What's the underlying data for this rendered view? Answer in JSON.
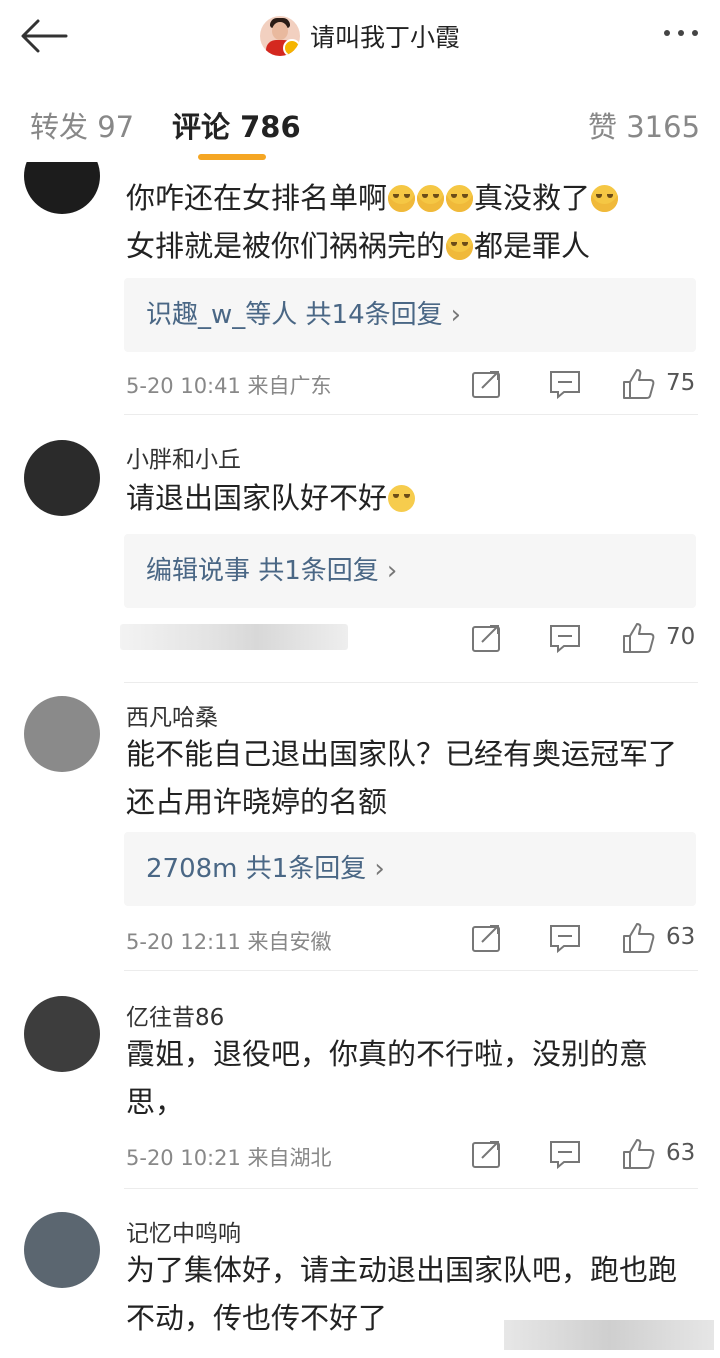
{
  "header": {
    "title": "请叫我丁小霞",
    "back_icon": "back-arrow-icon",
    "more_icon": "more-dots-icon"
  },
  "tabs": [
    {
      "label": "转发 97"
    },
    {
      "label": "评论 786"
    },
    {
      "label": "赞 3165"
    }
  ],
  "accent_color": "#f5a623",
  "link_color": "#4a6785",
  "comments": [
    {
      "name": "",
      "text": "你咋还在女排名单啊",
      "text_b": "真没救了",
      "text_c": "女排就是被你们祸祸完的",
      "text_d": "都是罪人",
      "reply": "识趣_w_等人  共14条回复",
      "meta": "5-20 10:41 来自广东",
      "likes": "75"
    },
    {
      "name": "小胖和小丘",
      "text": "请退出国家队好不好",
      "reply": "编辑说事  共1条回复",
      "meta": "",
      "likes": "70"
    },
    {
      "name": "西凡哈桑",
      "text": "能不能自己退出国家队？已经有奥运冠军了还占用许晓婷的名额",
      "reply": "2708m  共1条回复",
      "meta": "5-20 12:11 来自安徽",
      "likes": "63"
    },
    {
      "name": "亿往昔86",
      "text": "霞姐，退役吧，你真的不行啦，没别的意思，",
      "meta": "5-20 10:21 来自湖北",
      "likes": "63"
    },
    {
      "name": "记忆中鸣响",
      "text": "为了集体好，请主动退出国家队吧，跑也跑不动，传也传不好了"
    }
  ]
}
